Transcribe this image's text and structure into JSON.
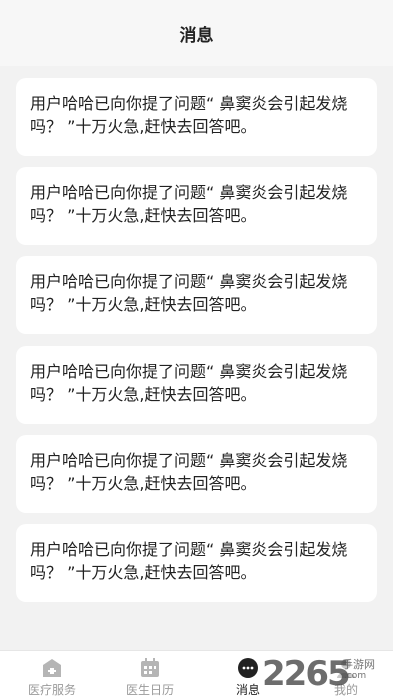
{
  "header": {
    "title": "消息"
  },
  "messages": [
    {
      "text": "用户哈哈已向你提了问题“ 鼻窦炎会引起发烧吗？ ”十万火急,赶快去回答吧。"
    },
    {
      "text": "用户哈哈已向你提了问题“ 鼻窦炎会引起发烧吗？ ”十万火急,赶快去回答吧。"
    },
    {
      "text": "用户哈哈已向你提了问题“ 鼻窦炎会引起发烧吗？ ”十万火急,赶快去回答吧。"
    },
    {
      "text": "用户哈哈已向你提了问题“ 鼻窦炎会引起发烧吗？ ”十万火急,赶快去回答吧。"
    },
    {
      "text": "用户哈哈已向你提了问题“ 鼻窦炎会引起发烧吗？ ”十万火急,赶快去回答吧。"
    },
    {
      "text": "用户哈哈已向你提了问题“ 鼻窦炎会引起发烧吗？ ”十万火急,赶快去回答吧。"
    }
  ],
  "tabbar": {
    "items": [
      {
        "label": "医疗服务",
        "icon": "home-icon"
      },
      {
        "label": "医生日历",
        "icon": "calendar-icon"
      },
      {
        "label": "消息",
        "icon": "message-icon",
        "active": true
      },
      {
        "label": "我的",
        "icon": "profile-icon"
      }
    ]
  },
  "watermark": {
    "number": "2265",
    "line1": "手游网",
    "line2": ".com"
  },
  "colors": {
    "background": "#f2f2f2",
    "card": "#ffffff",
    "tab_inactive": "#9a9a9a",
    "tab_active": "#222222"
  }
}
